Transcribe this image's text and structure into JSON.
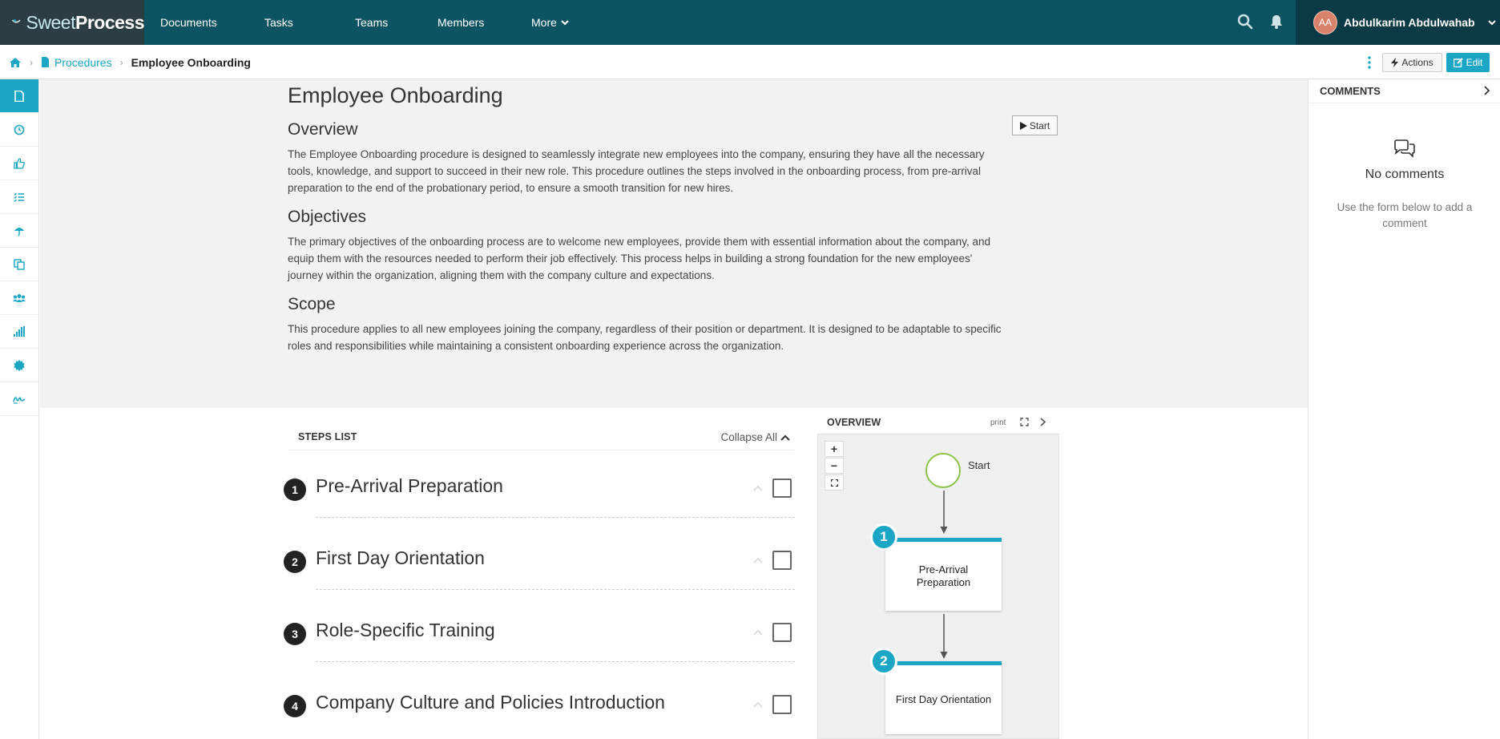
{
  "brand": {
    "name_light": "Sweet",
    "name_bold": "Process"
  },
  "nav": {
    "items": [
      {
        "label": "Documents"
      },
      {
        "label": "Tasks"
      },
      {
        "label": "Teams"
      },
      {
        "label": "Members"
      },
      {
        "label": "More"
      }
    ],
    "user": {
      "initials": "AA",
      "name": "Abdulkarim Abdulwahab"
    }
  },
  "breadcrumb": {
    "parent": "Procedures",
    "current": "Employee Onboarding"
  },
  "toolbar": {
    "actions_label": "Actions",
    "edit_label": "Edit"
  },
  "document": {
    "title": "Employee Onboarding",
    "start_label": "Start",
    "sections": [
      {
        "heading": "Overview",
        "body": "The Employee Onboarding procedure is designed to seamlessly integrate new employees into the company, ensuring they have all the necessary tools, knowledge, and support to succeed in their new role. This procedure outlines the steps involved in the onboarding process, from pre-arrival preparation to the end of the probationary period, to ensure a smooth transition for new hires."
      },
      {
        "heading": "Objectives",
        "body": "The primary objectives of the onboarding process are to welcome new employees, provide them with essential information about the company, and equip them with the resources needed to perform their job effectively. This process helps in building a strong foundation for the new employees' journey within the organization, aligning them with the company culture and expectations."
      },
      {
        "heading": "Scope",
        "body": "This procedure applies to all new employees joining the company, regardless of their position or department. It is designed to be adaptable to specific roles and responsibilities while maintaining a consistent onboarding experience across the organization."
      }
    ]
  },
  "steps_list": {
    "heading": "STEPS LIST",
    "collapse_label": "Collapse All",
    "steps": [
      {
        "num": "1",
        "name": "Pre-Arrival Preparation"
      },
      {
        "num": "2",
        "name": "First Day Orientation"
      },
      {
        "num": "3",
        "name": "Role-Specific Training"
      },
      {
        "num": "4",
        "name": "Company Culture and Policies Introduction"
      }
    ]
  },
  "flow": {
    "heading": "OVERVIEW",
    "print_label": "print",
    "zoom_in": "+",
    "zoom_out": "−",
    "start_label": "Start",
    "nodes": [
      {
        "num": "1",
        "label": "Pre-Arrival Preparation"
      },
      {
        "num": "2",
        "label": "First Day Orientation"
      }
    ]
  },
  "comments": {
    "heading": "COMMENTS",
    "empty_title": "No comments",
    "empty_hint": "Use the form below to add a comment"
  },
  "colors": {
    "nav_bg": "#0d5463",
    "accent": "#1aa6c4",
    "user_bg": "#0a3a45"
  }
}
